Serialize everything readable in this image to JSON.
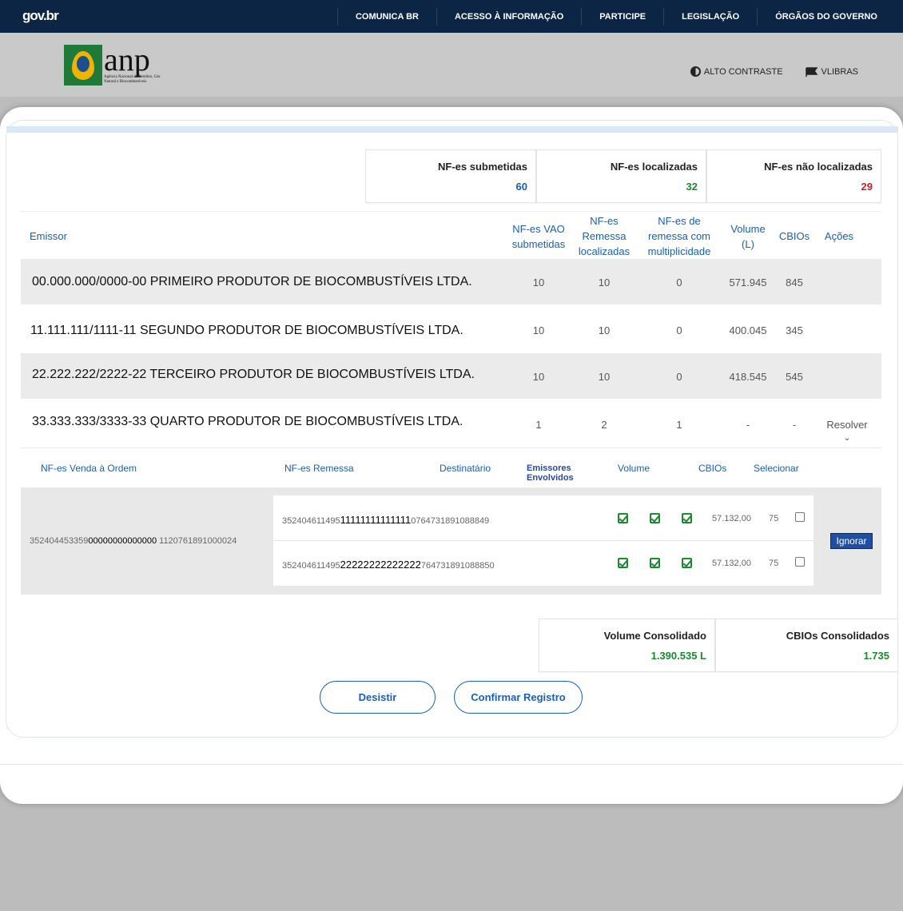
{
  "govbar": {
    "logo": "gov.br",
    "nav": [
      "COMUNICA BR",
      "ACESSO À INFORMAÇÃO",
      "PARTICIPE",
      "LEGISLAÇÃO",
      "ÓRGÃOS DO GOVERNO"
    ]
  },
  "header": {
    "anp_logo": "anp",
    "anp_tagline": "Agência Nacional do Petróleo, Gás Natural e Biocombustíveis",
    "alto_contraste": "ALTO CONTRASTE",
    "vlibras": "VLIBRAS"
  },
  "stats": {
    "submetidas_label": "NF-es submetidas",
    "submetidas_value": "60",
    "localizadas_label": "NF-es localizadas",
    "localizadas_value": "32",
    "nao_localizadas_label": "NF-es não localizadas",
    "nao_localizadas_value": "29"
  },
  "table": {
    "headers": {
      "emissor": "Emissor",
      "vao": "NF-es VAO submetidas",
      "remessa": "NF-es Remessa localizadas",
      "multiplicidade": "NF-es de remessa com multiplicidade",
      "volume": "Volume (L)",
      "cbios": "CBIOs",
      "acoes": "Ações"
    },
    "rows": [
      {
        "emissor": "00.000.000/0000-00 PRIMEIRO PRODUTOR DE BIOCOMBUSTÍVEIS LTDA.",
        "vao": "10",
        "remessa": "10",
        "mult": "0",
        "volume": "571.945",
        "cbios": "845",
        "acao": ""
      },
      {
        "emissor": "11.111.111/1111-11 SEGUNDO PRODUTOR DE BIOCOMBUSTÍVEIS LTDA.",
        "vao": "10",
        "remessa": "10",
        "mult": "0",
        "volume": "400.045",
        "cbios": "345",
        "acao": ""
      },
      {
        "emissor": "22.222.222/2222-22 TERCEIRO PRODUTOR DE BIOCOMBUSTÍVEIS LTDA.",
        "vao": "10",
        "remessa": "10",
        "mult": "0",
        "volume": "418.545",
        "cbios": "545",
        "acao": ""
      },
      {
        "emissor": "33.333.333/3333-33 QUARTO PRODUTOR DE BIOCOMBUSTÍVEIS LTDA.",
        "vao": "1",
        "remessa": "2",
        "mult": "1",
        "volume": "-",
        "cbios": "-",
        "acao": "Resolver"
      }
    ]
  },
  "subtable": {
    "headers": {
      "vao": "NF-es Venda à Ordem",
      "remessa": "NF-es Remessa",
      "destinatario": "Destinatário",
      "emissores": "Emissores Envolvidos",
      "volume": "Volume",
      "cbios": "CBIOs",
      "selecionar": "Selecionar"
    },
    "vao_key_prefix": "352404453359",
    "vao_key_mid": "00000000000000",
    "vao_key_suffix": "1120761891000024",
    "rows": [
      {
        "prefix": "352404611495",
        "mid": "11111111111111",
        "suffix": "0764731891088849",
        "volume": "57.132,00",
        "cbios": "75"
      },
      {
        "prefix": "352404611495",
        "mid": "22222222222222",
        "suffix": "764731891088850",
        "volume": "57.132,00",
        "cbios": "75"
      }
    ],
    "ignorar": "Ignorar"
  },
  "consolidado": {
    "volume_label": "Volume Consolidado",
    "volume_value": "1.390.535 L",
    "cbios_label": "CBIOs Consolidados",
    "cbios_value": "1.735"
  },
  "actions": {
    "desistir": "Desistir",
    "confirmar": "Confirmar Registro"
  },
  "colors": {
    "govbar": "#0c2544",
    "link_blue": "#1a5fb4",
    "green": "#1b8a2e",
    "red": "#c0262d"
  }
}
